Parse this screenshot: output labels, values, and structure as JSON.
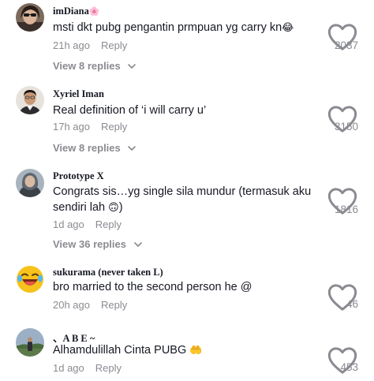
{
  "comments": [
    {
      "username": "imDiana",
      "username_emoji": "🌸",
      "text": "msti dkt pubg pengantin prmpuan yg carry kn",
      "text_emoji": "😂",
      "time": "21h ago",
      "reply_label": "Reply",
      "likes": "2037",
      "view_replies": "View 8 replies",
      "avatar": "woman-sunglasses-avatar"
    },
    {
      "username": "Xyriel Iman",
      "text": "Real definition of ‘i will carry u’",
      "time": "17h ago",
      "reply_label": "Reply",
      "likes": "3150",
      "view_replies": "View 8 replies",
      "avatar": "man-portrait-avatar"
    },
    {
      "username": "Prototype X",
      "text": "Congrats sis…yg single sila mundur (termasuk aku sendiri lah",
      "text_emoji": "🙃",
      "text_suffix": ")",
      "time": "1d ago",
      "reply_label": "Reply",
      "likes": "1816",
      "view_replies": "View 36 replies",
      "avatar": "hijab-woman-avatar"
    },
    {
      "username": "sukurama (never taken L)",
      "text": "bro married to the second person he @",
      "time": "20h ago",
      "reply_label": "Reply",
      "likes": "46",
      "avatar": "laughing-emoji-avatar"
    },
    {
      "username": "、A B E ~",
      "text": "Alhamdulillah Cinta PUBG",
      "text_emoji": "🤲",
      "time": "1d ago",
      "reply_label": "Reply",
      "likes": "453",
      "avatar": "outdoor-person-avatar"
    }
  ],
  "icons": {
    "like": "heart-outline-icon",
    "expand": "chevron-down-icon"
  },
  "colors": {
    "text": "#161823",
    "secondary": "#8a8b91",
    "background": "#ffffff"
  }
}
